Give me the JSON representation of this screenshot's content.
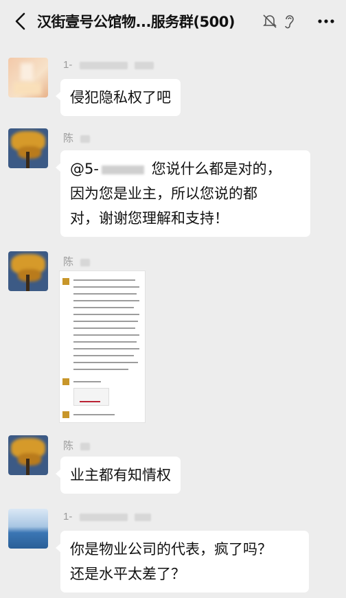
{
  "header": {
    "title": "汉街壹号公馆物...服务群(500)",
    "icons": [
      "back-arrow-icon",
      "mute-bell-icon",
      "ear-icon",
      "more-dots-icon"
    ]
  },
  "messages": [
    {
      "sender": "1-",
      "avatar": "blurred-avatar-1",
      "text": "侵犯隐私权了吧"
    },
    {
      "sender": "陈",
      "avatar": "tree-avatar",
      "mention": "@5-",
      "line1": "您说什么都是对的，",
      "line2": "因为您是业主，所以您说的都",
      "line3": "对，谢谢您理解和支持！"
    },
    {
      "sender": "陈",
      "avatar": "tree-avatar",
      "type": "image",
      "image_desc": "screenshot-of-chat"
    },
    {
      "sender": "陈",
      "avatar": "tree-avatar",
      "text": "业主都有知情权"
    },
    {
      "sender": "1-",
      "avatar": "sea-avatar",
      "line1": "你是物业公司的代表，疯了吗？",
      "line2": "还是水平太差了？"
    }
  ],
  "colors": {
    "background": "#ededed",
    "bubble": "#ffffff",
    "name": "#9a9a9a"
  }
}
